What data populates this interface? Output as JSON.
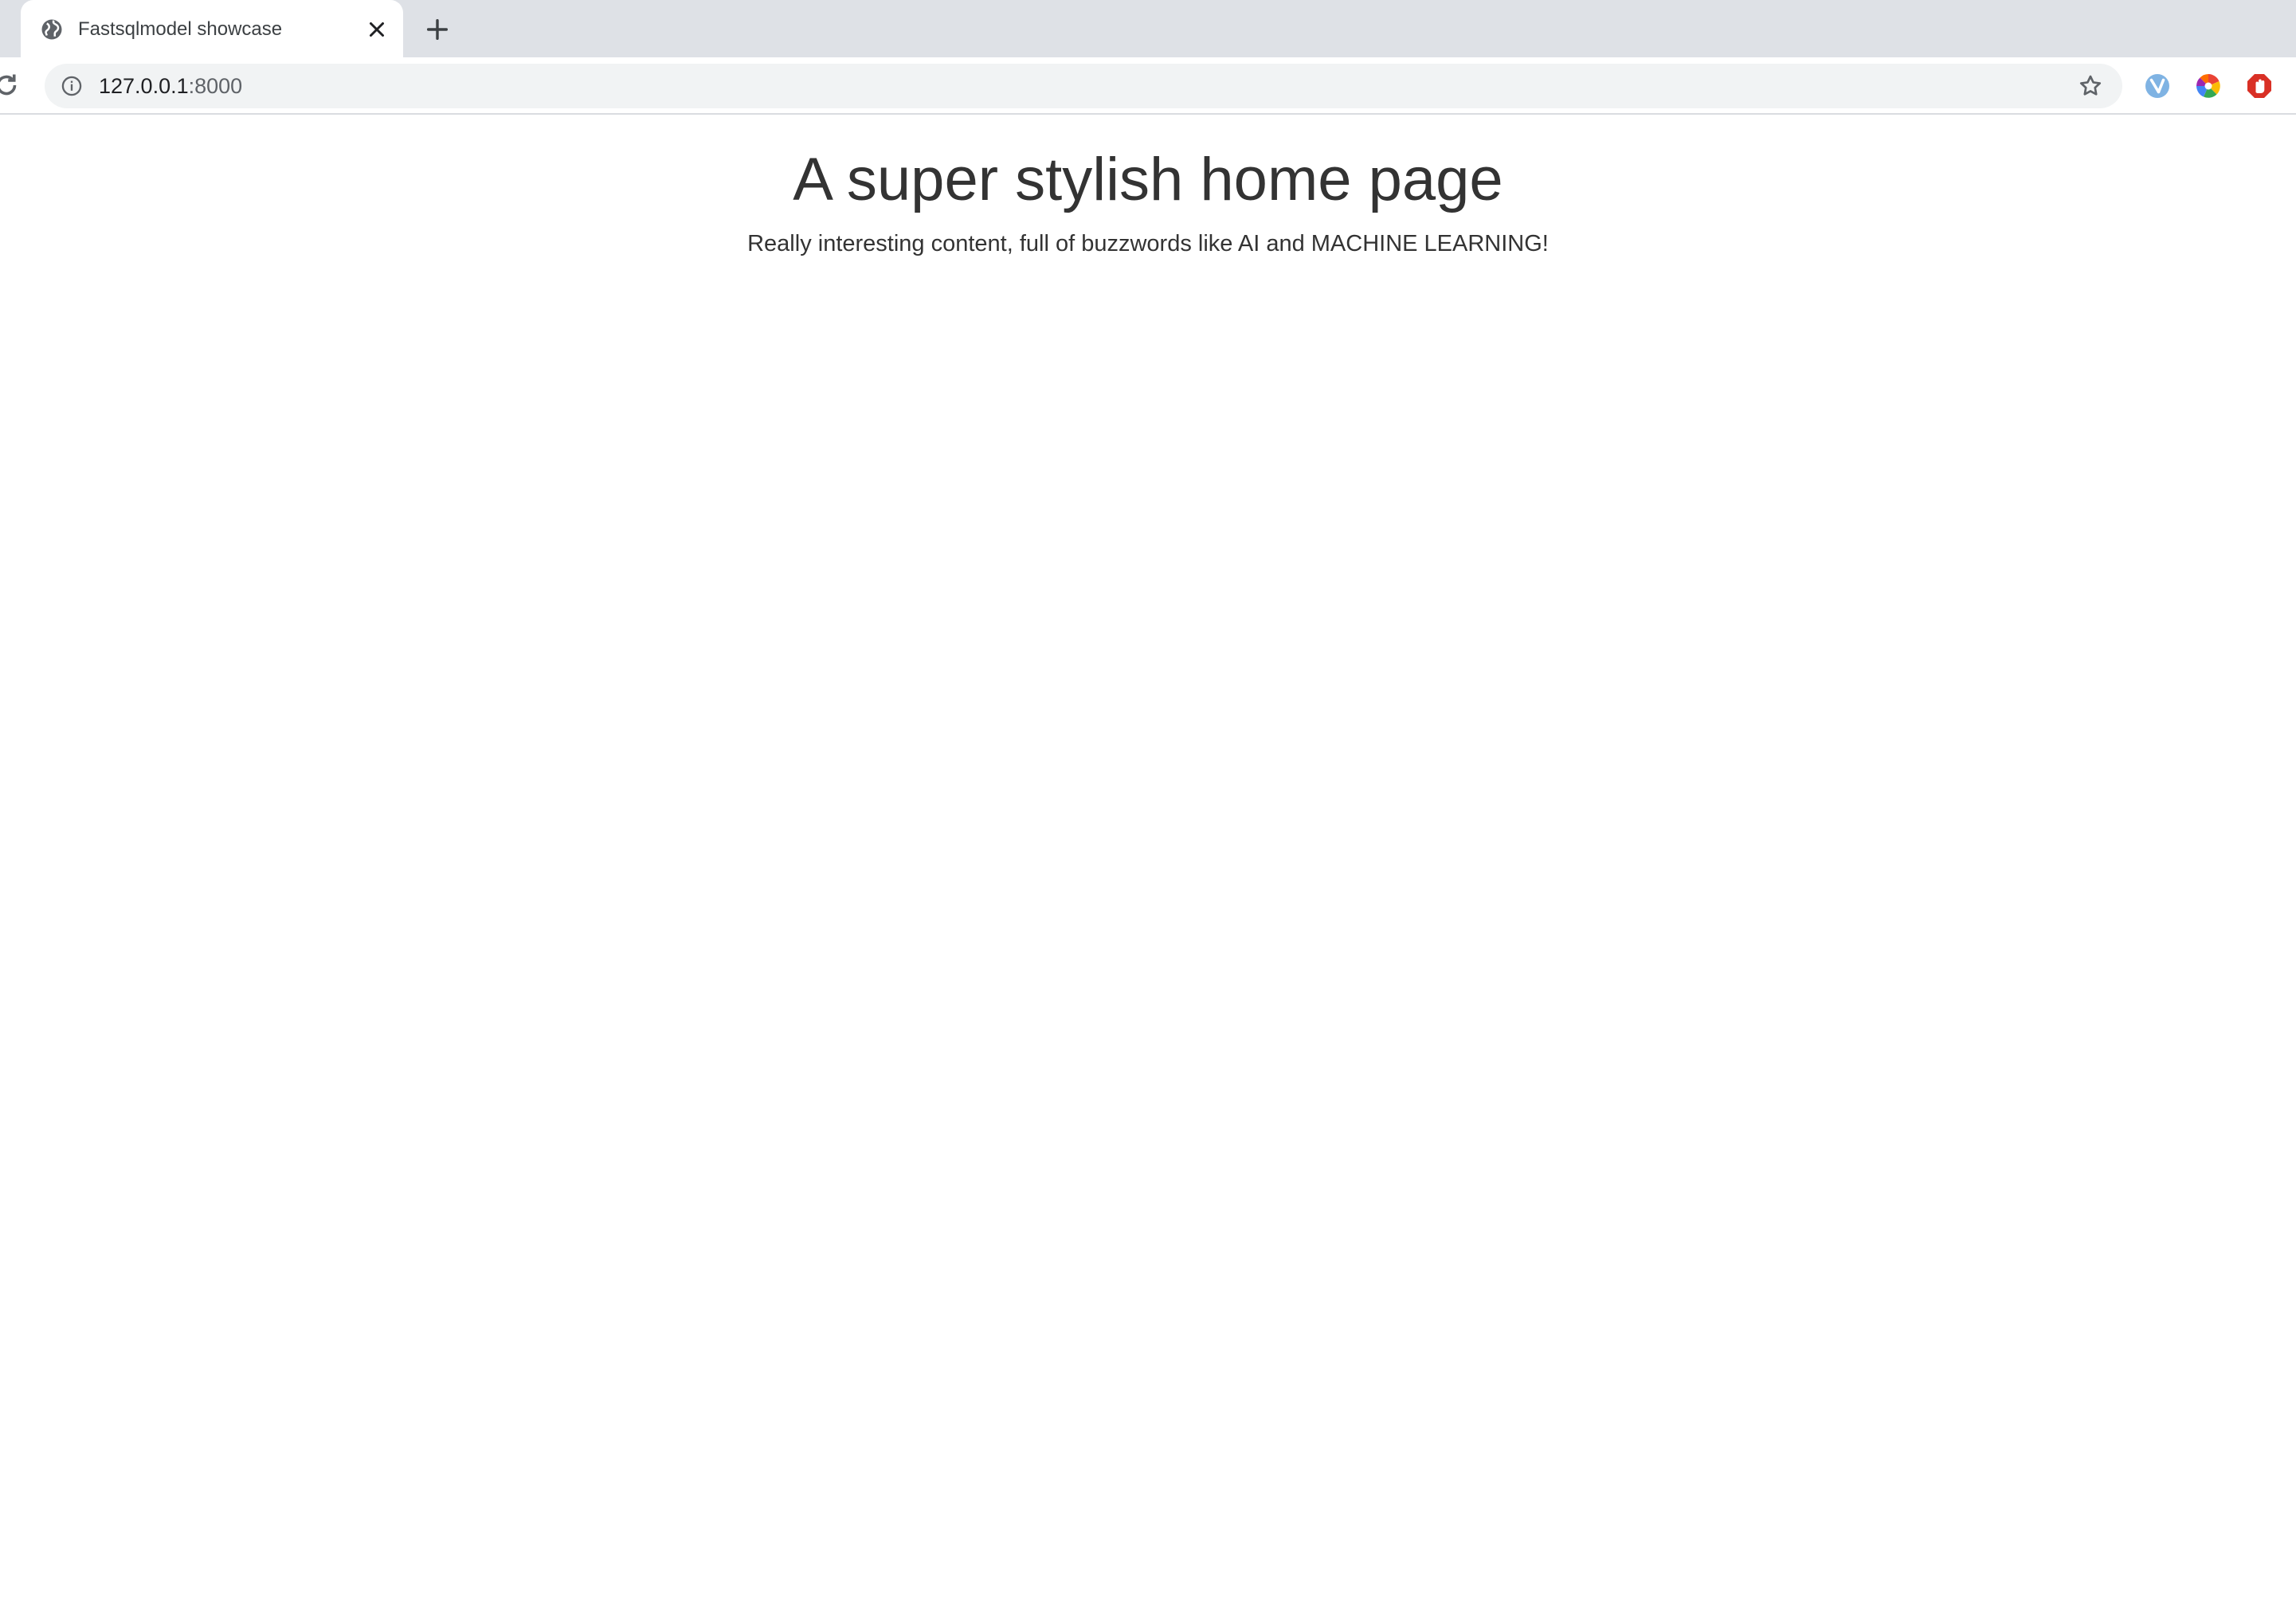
{
  "browser": {
    "tab": {
      "title": "Fastsqlmodel showcase",
      "favicon": "globe-icon"
    },
    "new_tab_icon": "plus-icon",
    "address_bar": {
      "host": "127.0.0.1",
      "port": ":8000",
      "security_icon": "info-icon"
    },
    "extensions": [
      "extension-icon",
      "color-wheel-icon",
      "ad-blocker-icon"
    ]
  },
  "page": {
    "heading": "A super stylish home page",
    "subheading": "Really interesting content, full of buzzwords like AI and MACHINE LEARNING!"
  },
  "colors": {
    "tab_strip": "#dee1e6",
    "omnibox": "#f1f3f4",
    "text": "#333333"
  }
}
